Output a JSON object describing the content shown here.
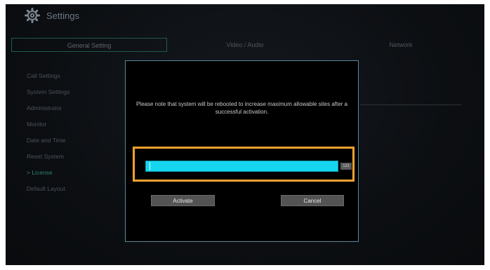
{
  "header": {
    "title": "Settings",
    "icon": "gear-icon"
  },
  "tabs": [
    {
      "label": "General Setting",
      "active": true
    },
    {
      "label": "Video / Audio",
      "active": false
    },
    {
      "label": "Network",
      "active": false
    }
  ],
  "sidebar": {
    "items": [
      {
        "label": "Call Settings",
        "active": false
      },
      {
        "label": "System Settings",
        "active": false
      },
      {
        "label": "Administrator",
        "active": false
      },
      {
        "label": "Monitor",
        "active": false
      },
      {
        "label": "Date and Time",
        "active": false
      },
      {
        "label": "Reset System",
        "active": false
      },
      {
        "label": "> License",
        "active": true
      },
      {
        "label": "Default Layout",
        "active": false
      }
    ]
  },
  "dialog": {
    "message": "Please note that system will be rebooted to increase maximum allowable sites after a successful activation.",
    "input": {
      "value": "",
      "placeholder": ""
    },
    "ime_indicator": "123",
    "activate_label": "Activate",
    "cancel_label": "Cancel"
  },
  "colors": {
    "accent": "#15d6ee",
    "highlight": "#f2a230",
    "dialog_border": "#5d87a1",
    "active_sidebar": "#2f7f6e"
  }
}
